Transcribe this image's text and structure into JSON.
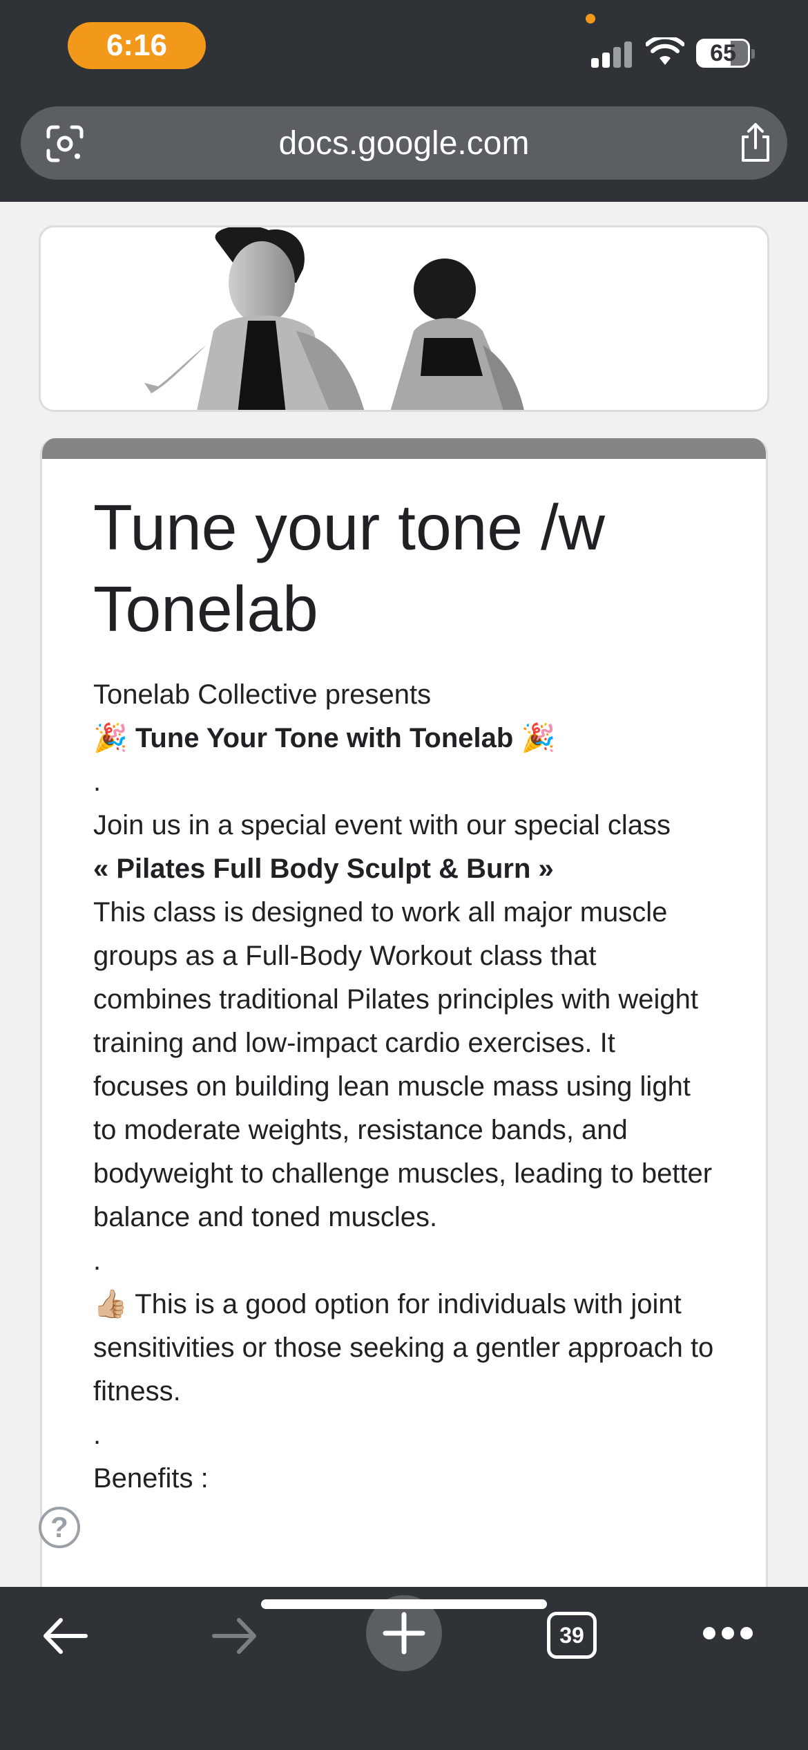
{
  "status_bar": {
    "time": "6:16",
    "battery": "65"
  },
  "browser": {
    "url": "docs.google.com",
    "tab_count": "39"
  },
  "form": {
    "title": "Tune your tone /w Tonelab",
    "description": {
      "presenter": "Tonelab Collective presents",
      "party_emoji": "🎉",
      "event_name": "Tune Your Tone with Tonelab",
      "dot": ".",
      "intro": "Join us in a special event with our special class",
      "class_name": "« Pilates Full Body Sculpt & Burn »",
      "class_description": "This class is designed to work all major muscle groups as a Full-Body Workout class that combines traditional Pilates principles with weight training and low-impact cardio exercises. It focuses on building lean muscle mass using light to moderate weights, resistance bands, and bodyweight to challenge muscles, leading to better balance and toned muscles.",
      "thumbs_emoji": "👍🏼",
      "gentle_note": "This is a good option for individuals with joint sensitivities or those seeking a gentler approach to fitness.",
      "benefits_label": "Benefits :"
    }
  },
  "help": {
    "symbol": "?"
  },
  "colors": {
    "chrome": "#2f3236",
    "time_pill": "#f2991b",
    "card_header_bar": "#858585"
  }
}
